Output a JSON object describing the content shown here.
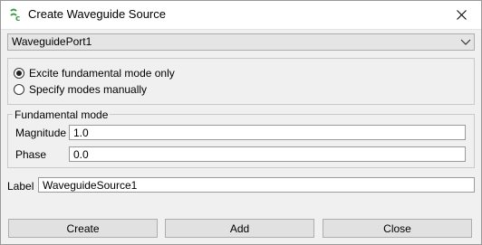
{
  "window": {
    "title": "Create Waveguide Source"
  },
  "port_select": {
    "value": "WaveguidePort1"
  },
  "mode_options": [
    {
      "label": "Excite fundamental mode only",
      "checked": true
    },
    {
      "label": "Specify modes manually",
      "checked": false
    }
  ],
  "fundamental": {
    "group_title": "Fundamental mode",
    "magnitude_label": "Magnitude",
    "magnitude_value": "1.0",
    "phase_label": "Phase",
    "phase_value": "0.0"
  },
  "label_field": {
    "label": "Label",
    "value": "WaveguideSource1"
  },
  "buttons": {
    "create": "Create",
    "add": "Add",
    "close": "Close"
  }
}
